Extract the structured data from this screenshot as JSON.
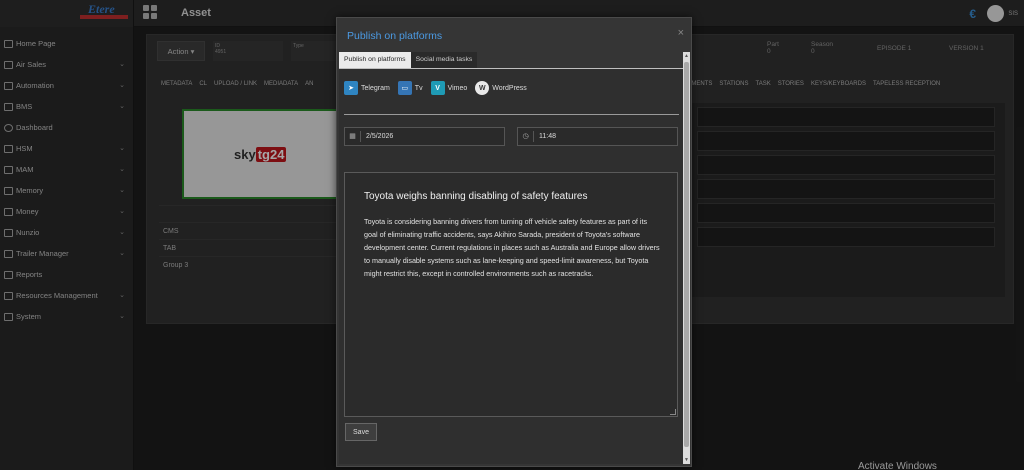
{
  "app": {
    "logo_text": "Etere",
    "page_title": "Asset",
    "user_initials": "SIS"
  },
  "sidebar": {
    "items": [
      {
        "label": "Home Page",
        "icon": "home-icon",
        "expandable": false
      },
      {
        "label": "Air Sales",
        "icon": "cart-icon",
        "expandable": true
      },
      {
        "label": "Automation",
        "icon": "automation-icon",
        "expandable": true
      },
      {
        "label": "BMS",
        "icon": "bms-icon",
        "expandable": true
      },
      {
        "label": "Dashboard",
        "icon": "dashboard-icon",
        "expandable": false
      },
      {
        "label": "HSM",
        "icon": "hsm-icon",
        "expandable": true
      },
      {
        "label": "MAM",
        "icon": "mam-icon",
        "expandable": true
      },
      {
        "label": "Memory",
        "icon": "memory-icon",
        "expandable": true
      },
      {
        "label": "Money",
        "icon": "money-icon",
        "expandable": true
      },
      {
        "label": "Nunzio",
        "icon": "nunzio-icon",
        "expandable": true
      },
      {
        "label": "Trailer Manager",
        "icon": "trailer-icon",
        "expandable": true
      },
      {
        "label": "Reports",
        "icon": "reports-icon",
        "expandable": false
      },
      {
        "label": "Resources Management",
        "icon": "resources-icon",
        "expandable": true
      },
      {
        "label": "System",
        "icon": "system-icon",
        "expandable": true
      }
    ]
  },
  "background": {
    "action_label": "Action",
    "field_id_label": "ID",
    "field_id_value": "4951",
    "field_type_label": "Type",
    "part_label": "Part",
    "part_value": "0",
    "season_label": "Season",
    "season_value": "0",
    "episode_label": "EPISODE",
    "episode_value": "1",
    "version_label": "VERSION",
    "version_value": "1",
    "tabs_left": [
      "METADATA",
      "CL",
      "UPLOAD / LINK",
      "MEDIADATA",
      "AN"
    ],
    "tabs_right": [
      "UMENTS",
      "STATIONS",
      "TASK",
      "STORIES",
      "KEYS/KEYBOARDS",
      "TAPELESS RECEPTION"
    ],
    "thumb_logo_sky": "sky",
    "thumb_logo_tg": "tg24",
    "meta_rows": [
      "CMS",
      "TAB",
      "Group 3"
    ]
  },
  "modal": {
    "title": "Publish on platforms",
    "tabs": [
      {
        "label": "Publish on platforms",
        "active": true
      },
      {
        "label": "Social media tasks",
        "active": false
      }
    ],
    "platforms": [
      {
        "label": "Telegram",
        "icon": "telegram-icon"
      },
      {
        "label": "Tv",
        "icon": "tv-icon"
      },
      {
        "label": "Vimeo",
        "icon": "vimeo-icon"
      },
      {
        "label": "WordPress",
        "icon": "wordpress-icon"
      }
    ],
    "date_value": "2/5/2026",
    "time_value": "11:48",
    "editor": {
      "title": "Toyota weighs banning disabling of safety features",
      "body": "Toyota is considering banning drivers from turning off vehicle safety features as part of its goal of eliminating traffic accidents, says Akihiro Sarada, president of Toyota's software development center. Current regulations in places such as Australia and Europe allow drivers to manually disable systems such as lane-keeping and speed-limit awareness, but Toyota might restrict this, except in controlled environments such as racetracks."
    },
    "save_label": "Save"
  },
  "watermark": "Activate Windows",
  "colors": {
    "accent": "#4b9ae3",
    "thumbnail_border": "#2a8a2a",
    "tg24_red": "#c0161c"
  }
}
